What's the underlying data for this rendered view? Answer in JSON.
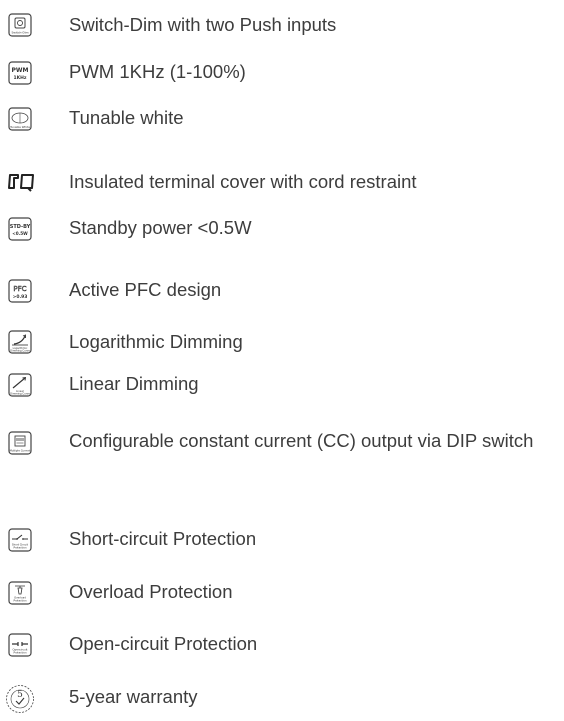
{
  "features": [
    {
      "icon": "switch-dim-icon",
      "icon_text": "Switch-Dim",
      "label": "Switch-Dim with two Push inputs"
    },
    {
      "icon": "pwm-icon",
      "icon_text": [
        "PWM",
        "1KHz"
      ],
      "label": "PWM 1KHz (1-100%)"
    },
    {
      "icon": "tunable-white-icon",
      "icon_text": "Tunable White",
      "label": "Tunable white"
    },
    {
      "icon": "terminal-cover-icon",
      "label": "Insulated terminal cover with cord restraint"
    },
    {
      "icon": "standby-power-icon",
      "icon_text": [
        "STD-BY",
        "<0.5W"
      ],
      "label": "Standby power <0.5W"
    },
    {
      "icon": "pfc-icon",
      "icon_text": [
        "PFC",
        ">0.93"
      ],
      "label": "Active PFC design"
    },
    {
      "icon": "logarithmic-dimming-icon",
      "icon_text": [
        "Logarithmic",
        "Dimming Curve"
      ],
      "label": "Logarithmic Dimming"
    },
    {
      "icon": "linear-dimming-icon",
      "icon_text": [
        "Linear",
        "Dimming Curve"
      ],
      "label": "Linear Dimming"
    },
    {
      "icon": "multiple-current-icon",
      "icon_text": "Multiple Current",
      "label": "Configurable constant current (CC) output via DIP switch"
    },
    {
      "icon": "short-circuit-icon",
      "icon_text": [
        "Short Circuit",
        "Protection"
      ],
      "label": "Short-circuit Protection"
    },
    {
      "icon": "overload-icon",
      "icon_text": [
        "Overload",
        "Protection"
      ],
      "label": "Overload Protection"
    },
    {
      "icon": "open-circuit-icon",
      "icon_text": [
        "Opencircuit",
        "Protection"
      ],
      "label": "Open-circuit Protection"
    },
    {
      "icon": "warranty-icon",
      "icon_text": "5",
      "label": "5-year warranty"
    }
  ]
}
